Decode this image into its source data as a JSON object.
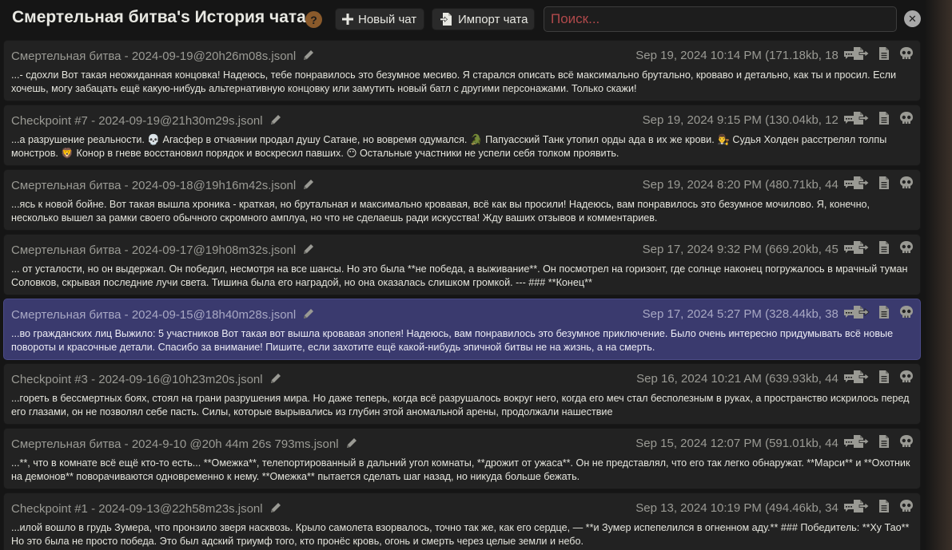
{
  "header": {
    "title": "Смертельная битва's История чата",
    "help_glyph": "?",
    "new_chat_label": "Новый чат",
    "import_chat_label": "Импорт чата",
    "search_placeholder": "Поиск...",
    "close_glyph": "✕"
  },
  "chats": [
    {
      "filename": "Смертельная битва - 2024-09-19@20h26m08s.jsonl",
      "meta": "Sep 19, 2024 10:14 PM (171.18kb, 18",
      "preview": "...- сдохли Вот такая неожиданная концовка! Надеюсь, тебе понравилось это безумное месиво. Я старался описать всё максимально брутально, кроваво и детально, как ты и просил. Если хочешь, могу забацать ещё какую-нибудь альтернативную концовку или замутить новый батл с другими персонажами. Только скажи!",
      "selected": false
    },
    {
      "filename": "Checkpoint #7 - 2024-09-19@21h30m29s.jsonl",
      "meta": "Sep 19, 2024 9:15 PM (130.04kb, 12",
      "preview": "...а разрушение реальности. 💀 Агасфер в отчаянии продал душу Сатане, но вовремя одумался. 🐊 Папуасский Танк утопил орды ада в их же крови. 👨‍⚖️ Судья Холден расстрелял толпы монстров. 🦁 Конор в гневе восстановил порядок и воскресил павших. 😶 Остальные участники не успели себя толком проявить.",
      "selected": false
    },
    {
      "filename": "Смертельная битва - 2024-09-18@19h16m42s.jsonl",
      "meta": "Sep 19, 2024 8:20 PM (480.71kb, 44",
      "preview": "...ясь к новой бойне. Вот такая вышла хроника - краткая, но брутальная и максимально кровавая, всё как вы просили! Надеюсь, вам понравилось это безумное мочилово. Я, конечно, несколько вышел за рамки своего обычного скромного амплуа, но что не сделаешь ради искусства! Жду ваших отзывов и комментариев.",
      "selected": false
    },
    {
      "filename": "Смертельная битва - 2024-09-17@19h08m32s.jsonl",
      "meta": "Sep 17, 2024 9:32 PM (669.20kb, 45",
      "preview": "... от усталости, но он выдержал. Он победил, несмотря на все шансы. Но это была **не победа, а выживание**. Он посмотрел на горизонт, где солнце наконец погружалось в мрачный туман Соловков, скрывая последние лучи света. Тишина была его наградой, но она оказалась слишком громкой. --- ### **Конец**",
      "selected": false
    },
    {
      "filename": "Смертельная битва - 2024-09-15@18h40m28s.jsonl",
      "meta": "Sep 17, 2024 5:27 PM (328.44kb, 38",
      "preview": "...во гражданских лиц Выжило: 5 участников Вот такая вот вышла кровавая эпопея! Надеюсь, вам понравилось это безумное приключение. Было очень интересно придумывать всё новые повороты и красочные детали. Спасибо за внимание! Пишите, если захотите ещё какой-нибудь эпичной битвы не на жизнь, а на смерть.",
      "selected": true
    },
    {
      "filename": "Checkpoint #3 - 2024-09-16@10h23m20s.jsonl",
      "meta": "Sep 16, 2024 10:21 AM (639.93kb, 44",
      "preview": "...гореть в бессмертных боях, стоял на грани разрушения мира. Но даже теперь, когда всё разрушалось вокруг него, когда его меч стал бесполезным в руках, а пространство искрилось перед его глазами, он не позволял себе пасть. Силы, которые вырывались из глубин этой аномальной арены, продолжали нашествие",
      "selected": false
    },
    {
      "filename": "Смертельная битва - 2024-9-10 @20h 44m 26s 793ms.jsonl",
      "meta": "Sep 15, 2024 12:07 PM (591.01kb, 44",
      "preview": "...**, что в комнате всё ещё кто-то есть... **Омежка**, телепортированный в дальний угол комнаты, **дрожит от ужаса**. Он не представлял, что его так легко обнаружат. **Марси** и **Охотник на демонов** поворачиваются одновременно к нему. **Омежка** пытается сделать шаг назад, но никуда больше бежать.",
      "selected": false
    },
    {
      "filename": "Checkpoint #1 - 2024-09-13@22h58m23s.jsonl",
      "meta": "Sep 13, 2024 10:19 PM (494.46kb, 34",
      "preview": "...илой вошло в грудь Зумера, что пронзило зверя насквозь. Крыло самолета взорвалось, точно так же, как его сердце, — **и Зумер испепелился в огненном аду.** ### Победитель: **Ху Тао** Но это была не просто победа. Это был адский триумф того, кто пронёс кровь, огонь и смерть через целые земли и небо.",
      "selected": false
    }
  ]
}
